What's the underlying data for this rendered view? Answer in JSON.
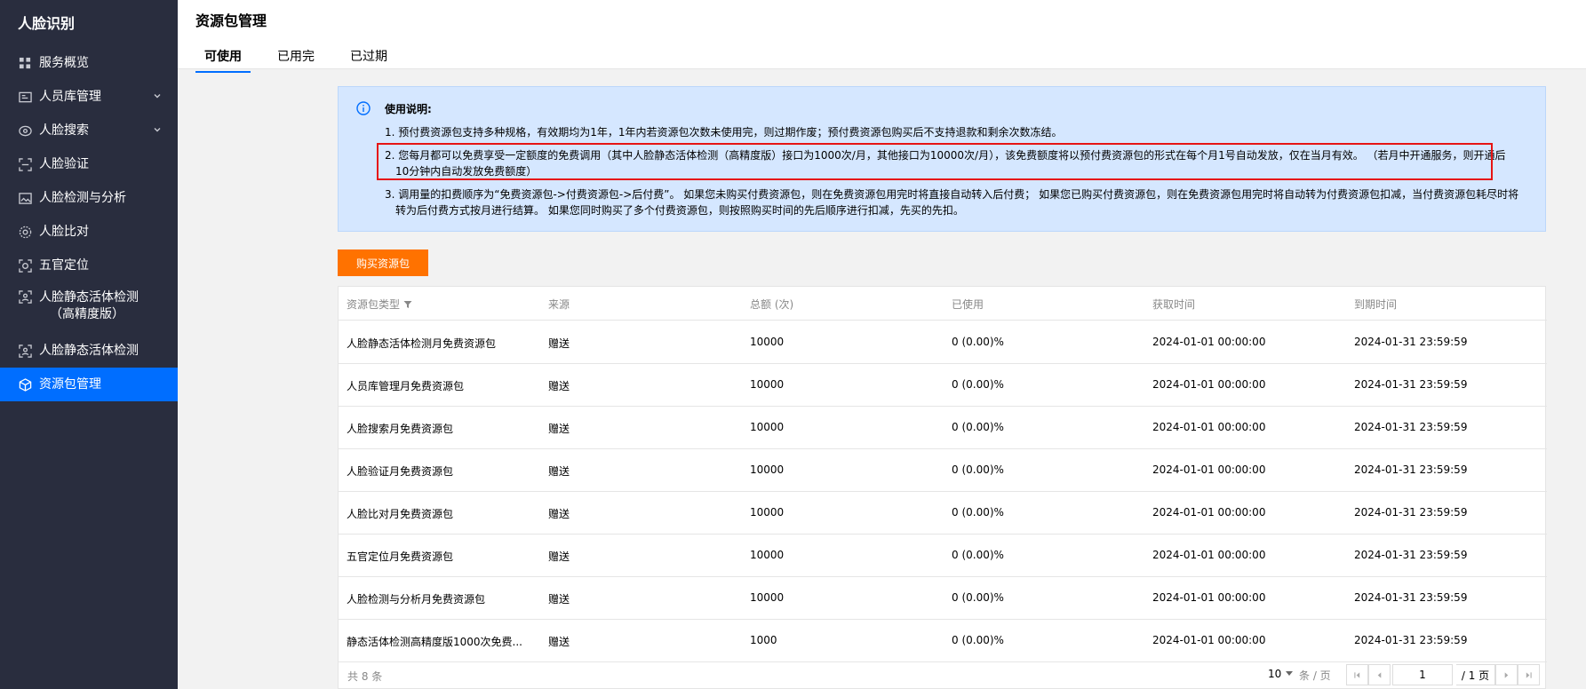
{
  "sidebar": {
    "title": "人脸识别",
    "items": [
      {
        "label": "服务概览",
        "icon": "grid-icon"
      },
      {
        "label": "人员库管理",
        "icon": "id-card-icon",
        "chevron": true
      },
      {
        "label": "人脸搜索",
        "icon": "face-search-icon",
        "chevron": true
      },
      {
        "label": "人脸验证",
        "icon": "scan-frame-icon"
      },
      {
        "label": "人脸检测与分析",
        "icon": "image-analysis-icon"
      },
      {
        "label": "人脸比对",
        "icon": "compare-icon"
      },
      {
        "label": "五官定位",
        "icon": "locate-icon"
      },
      {
        "label": "人脸静态活体检测",
        "label2": "（高精度版）",
        "icon": "liveness-hd-icon"
      },
      {
        "label": "人脸静态活体检测",
        "icon": "liveness-icon"
      },
      {
        "label": "资源包管理",
        "icon": "package-icon",
        "active": true
      }
    ]
  },
  "header": {
    "title": "资源包管理",
    "tabs": [
      {
        "label": "可使用",
        "active": true
      },
      {
        "label": "已用完"
      },
      {
        "label": "已过期"
      }
    ]
  },
  "notice": {
    "title": "使用说明:",
    "line1": "1. 预付费资源包支持多种规格，有效期均为1年，1年内若资源包次数未使用完，则过期作废；预付费资源包购买后不支持退款和剩余次数冻结。",
    "line2a": "2. 您每月都可以免费享受一定额度的免费调用（其中人脸静态活体检测（高精度版）接口为1000次/月，其他接口为10000次/月），该免费额度将以预付费资源包的形式在每个月1号自动发放，仅在当月有效。  （若月中开通服务，则开通后",
    "line2b": "10分钟内自动发放免费额度）",
    "line3a": "3. 调用量的扣费顺序为“免费资源包->付费资源包->后付费”。 如果您未购买付费资源包，则在免费资源包用完时将直接自动转入后付费； 如果您已购买付费资源包，则在免费资源包用完时将自动转为付费资源包扣减，当付费资源包耗尽时将",
    "line3b": "转为后付费方式按月进行结算。 如果您同时购买了多个付费资源包，则按照购买时间的先后顺序进行扣减，先买的先扣。"
  },
  "buy_button": "购买资源包",
  "table": {
    "headers": {
      "type": "资源包类型",
      "source": "来源",
      "total": "总额 (次)",
      "used": "已使用",
      "acquired": "获取时间",
      "expire": "到期时间"
    },
    "rows": [
      {
        "type": "人脸静态活体检测月免费资源包",
        "source": "赠送",
        "total": "10000",
        "used": "0 (0.00)%",
        "acquired": "2024-01-01 00:00:00",
        "expire": "2024-01-31 23:59:59"
      },
      {
        "type": "人员库管理月免费资源包",
        "source": "赠送",
        "total": "10000",
        "used": "0 (0.00)%",
        "acquired": "2024-01-01 00:00:00",
        "expire": "2024-01-31 23:59:59"
      },
      {
        "type": "人脸搜索月免费资源包",
        "source": "赠送",
        "total": "10000",
        "used": "0 (0.00)%",
        "acquired": "2024-01-01 00:00:00",
        "expire": "2024-01-31 23:59:59"
      },
      {
        "type": "人脸验证月免费资源包",
        "source": "赠送",
        "total": "10000",
        "used": "0 (0.00)%",
        "acquired": "2024-01-01 00:00:00",
        "expire": "2024-01-31 23:59:59"
      },
      {
        "type": "人脸比对月免费资源包",
        "source": "赠送",
        "total": "10000",
        "used": "0 (0.00)%",
        "acquired": "2024-01-01 00:00:00",
        "expire": "2024-01-31 23:59:59"
      },
      {
        "type": "五官定位月免费资源包",
        "source": "赠送",
        "total": "10000",
        "used": "0 (0.00)%",
        "acquired": "2024-01-01 00:00:00",
        "expire": "2024-01-31 23:59:59"
      },
      {
        "type": "人脸检测与分析月免费资源包",
        "source": "赠送",
        "total": "10000",
        "used": "0 (0.00)%",
        "acquired": "2024-01-01 00:00:00",
        "expire": "2024-01-31 23:59:59"
      },
      {
        "type": "静态活体检测高精度版1000次免费...",
        "source": "赠送",
        "total": "1000",
        "used": "0 (0.00)%",
        "acquired": "2024-01-01 00:00:00",
        "expire": "2024-01-31 23:59:59"
      }
    ]
  },
  "pagination": {
    "total_text": "共 8 条",
    "page_size": "10",
    "per_page_unit": "条 / 页",
    "current_page": "1",
    "total_pages": "/ 1 页"
  },
  "colors": {
    "sidebar_bg": "#292d3e",
    "active_blue": "#006eff",
    "notice_bg": "#d5e7ff",
    "buy_orange": "#ff7200",
    "highlight_red": "#e61414"
  }
}
